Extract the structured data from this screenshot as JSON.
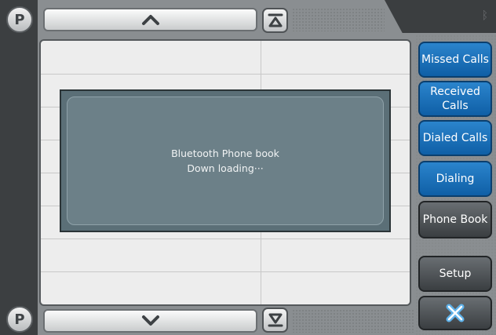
{
  "nav": {
    "top_p_label": "P",
    "bottom_p_label": "P"
  },
  "dialog": {
    "line1": "Bluetooth Phone book",
    "line2": "Down loading···"
  },
  "menu": {
    "missed_calls": "Missed Calls",
    "received_calls": "Received Calls",
    "dialed_calls": "Dialed Calls",
    "dialing": "Dialing",
    "phone_book": "Phone Book",
    "setup": "Setup"
  },
  "icons": {
    "bluetooth": "bluetooth-icon",
    "scroll_up": "chevron-up-icon",
    "scroll_down": "chevron-down-icon",
    "jump_top": "jump-to-top-icon",
    "jump_bottom": "jump-to-bottom-icon",
    "close": "close-icon"
  },
  "colors": {
    "active_blue": "#0f5fa6",
    "inactive_gray": "#4a4e51",
    "dialog_bg": "#6c8088"
  }
}
